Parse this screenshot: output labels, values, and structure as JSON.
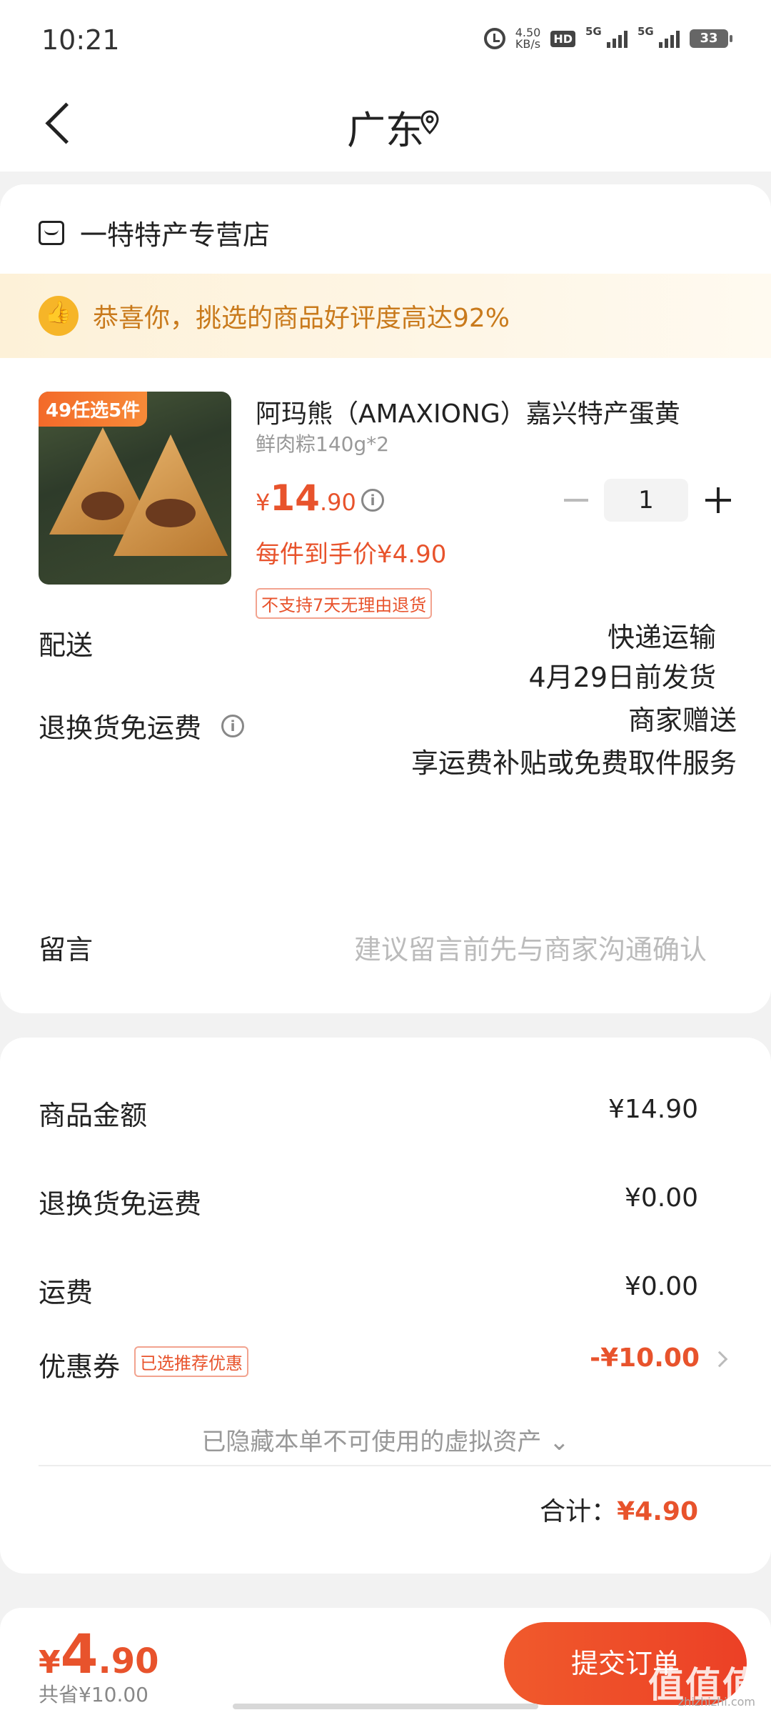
{
  "status_bar": {
    "time": "10:21",
    "speed_value": "4.50",
    "speed_unit": "KB/s",
    "hd": "HD",
    "net1": "5G",
    "net2": "5G",
    "battery": "33"
  },
  "header": {
    "title": "广东",
    "back_icon": "back-arrow-icon",
    "location_icon": "location-pin-icon"
  },
  "shop": {
    "name": "一特特产专营店",
    "icon": "store-icon"
  },
  "banner": {
    "text": "恭喜你，挑选的商品好评度高达92%",
    "icon": "thumbs-up-icon",
    "bg_color": "#fdf1d8",
    "text_color": "#c97a1c"
  },
  "product": {
    "promo_tag": "49任选5件",
    "title": "阿玛熊（AMAXIONG）嘉兴特产蛋黄",
    "spec": "鲜肉粽140g*2",
    "price_currency": "¥",
    "price_int": "14",
    "price_dec": ".90",
    "unit_price": "每件到手价¥4.90",
    "no_return": "不支持7天无理由退货",
    "quantity": "1"
  },
  "delivery": {
    "label": "配送",
    "method": "快递运输",
    "ship_date": "4月29日前发货"
  },
  "return_shipping": {
    "label": "退换货免运费",
    "value": "商家赠送",
    "desc": "享运费补贴或免费取件服务"
  },
  "message": {
    "label": "留言",
    "placeholder": "建议留言前先与商家沟通确认"
  },
  "summary": {
    "goods_label": "商品金额",
    "goods_value": "¥14.90",
    "return_label": "退换货免运费",
    "return_value": "¥0.00",
    "freight_label": "运费",
    "freight_value": "¥0.00",
    "coupon_label": "优惠券",
    "coupon_tag": "已选推荐优惠",
    "coupon_value": "-¥10.00",
    "hidden_note": "已隐藏本单不可使用的虚拟资产 ⌄",
    "total_label": "合计：",
    "total_value": "¥4.90"
  },
  "bottom_bar": {
    "price_currency": "¥",
    "price_int": "4",
    "price_dec": ".90",
    "saved": "共省¥10.00",
    "submit": "提交订单"
  },
  "watermark": {
    "text": "值值值",
    "sub": "zhizhizhi.com"
  },
  "colors": {
    "accent": "#e8532c",
    "button": "#ec4026"
  }
}
